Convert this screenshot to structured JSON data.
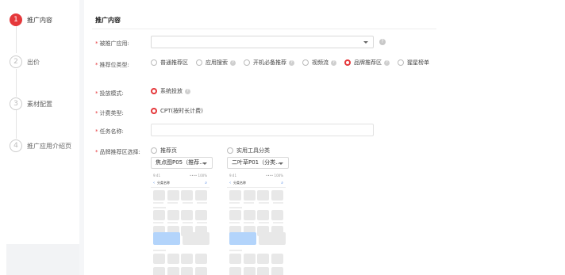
{
  "stepper": {
    "steps": [
      {
        "num": "1",
        "label": "推广内容"
      },
      {
        "num": "2",
        "label": "出价"
      },
      {
        "num": "3",
        "label": "素材配置"
      },
      {
        "num": "4",
        "label": "推广应用介绍页"
      }
    ]
  },
  "section": {
    "title": "推广内容"
  },
  "form": {
    "promoted_app": {
      "label": "被推广应用:",
      "value": ""
    },
    "position_type": {
      "label": "推荐位类型:",
      "options": [
        {
          "label": "普通推荐区",
          "selected": false,
          "help": false
        },
        {
          "label": "应用搜索",
          "selected": false,
          "help": true
        },
        {
          "label": "开机必备推荐",
          "selected": false,
          "help": true
        },
        {
          "label": "视频流",
          "selected": false,
          "help": true
        },
        {
          "label": "品牌推荐区",
          "selected": true,
          "help": true
        },
        {
          "label": "猩星榜单",
          "selected": false,
          "help": false
        }
      ]
    },
    "delivery_mode": {
      "label": "投放模式:",
      "option": "系统投放",
      "help": true
    },
    "billing_type": {
      "label": "计费类型:",
      "option": "CPT(按时长计费)"
    },
    "task_name": {
      "label": "任务名称:",
      "value": ""
    },
    "brand_area": {
      "label": "品牌推荐区选择:",
      "choices": [
        {
          "label": "推荐页",
          "select": "焦点图P05（推荐…"
        },
        {
          "label": "实用工具分类",
          "select": "二叶草P01（分类…"
        }
      ]
    }
  },
  "preview": {
    "status_left": "9:41",
    "status_right": "•••• 100%",
    "nav_title": "分类名称",
    "back_glyph": "‹",
    "search_glyph": "⌕",
    "banner_color": "#b3d4fb",
    "grey_color": "#e8e8e8"
  },
  "colors": {
    "accent": "#e5383b"
  }
}
